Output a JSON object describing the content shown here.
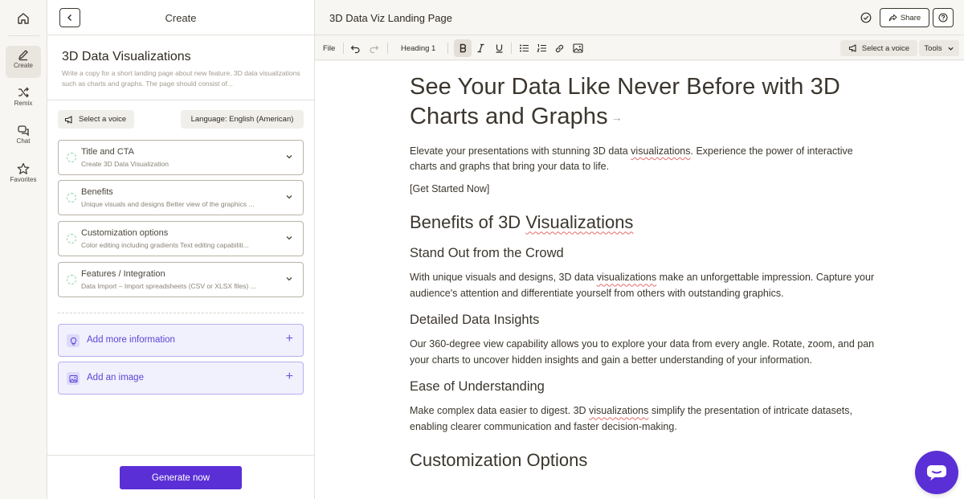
{
  "rail": {
    "items": [
      {
        "label": "Create"
      },
      {
        "label": "Remix"
      },
      {
        "label": "Chat"
      },
      {
        "label": "Favorites"
      }
    ]
  },
  "panel": {
    "title": "Create",
    "doc_title": "3D Data Visualizations",
    "doc_description": "Write a copy for a short landing page about new feature, 3D data visualizations such as charts and graphs. The page should consist of...",
    "voice_label": "Select a voice",
    "language_label": "Language: English (American)",
    "sections": [
      {
        "title": "Title and CTA",
        "subtitle": "Create 3D Data Visualization"
      },
      {
        "title": "Benefits",
        "subtitle": "Unique visuals and designs Better view of the graphics ..."
      },
      {
        "title": "Customization options",
        "subtitle": "Color editing including gradients Text editing capabiliti..."
      },
      {
        "title": "Features / Integration",
        "subtitle": "Data Import – Import spreadsheets (CSV or XLSX files) ..."
      }
    ],
    "add_info_label": "Add more information",
    "add_image_label": "Add an image",
    "generate_label": "Generate now"
  },
  "header": {
    "page_title": "3D Data Viz Landing Page",
    "share_label": "Share"
  },
  "toolbar": {
    "file_label": "File",
    "heading_label": "Heading 1",
    "voice_label": "Select a voice",
    "tools_label": "Tools"
  },
  "document": {
    "h1": "See Your Data Like Never Before with 3D Charts and Graphs",
    "intro_a": "Elevate your presentations with stunning 3D data ",
    "intro_word": "visualizations",
    "intro_b": ". Experience the power of interactive charts and graphs that bring your data to life.",
    "cta": "[Get Started Now]",
    "h2_benefits_a": "Benefits of 3D ",
    "h2_benefits_word": "Visualizations",
    "h3_standout": "Stand Out from the Crowd",
    "p_standout_a": "With unique visuals and designs, 3D data ",
    "p_standout_word": "visualizations",
    "p_standout_b": " make an unforgettable impression. Capture your audience's attention and differentiate yourself from others with outstanding graphics.",
    "h3_insights": "Detailed Data Insights",
    "p_insights": "Our 360-degree view capability allows you to explore your data from every angle. Rotate, zoom, and pan your charts to uncover hidden insights and gain a better understanding of your information.",
    "h3_ease": "Ease of Understanding",
    "p_ease_a": "Make complex data easier to digest. 3D ",
    "p_ease_word": "visualizations",
    "p_ease_b": " simplify the presentation of intricate datasets, enabling clearer communication and faster decision-making.",
    "h2_custom": "Customization Options"
  },
  "colors": {
    "accent": "#5b2fd6",
    "spell_error": "#e46a6a",
    "section_ring": "#8fd0a5"
  }
}
